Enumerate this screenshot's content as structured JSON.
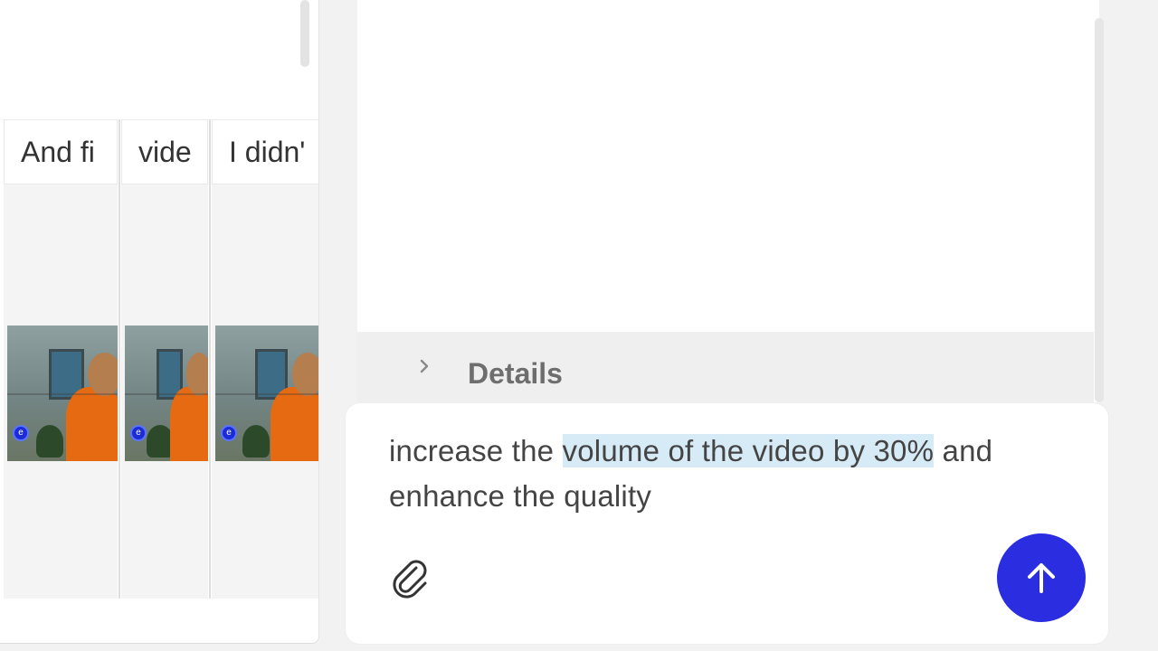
{
  "timeline": {
    "clips": [
      {
        "label": "And fi"
      },
      {
        "label": "vide"
      },
      {
        "label": "I didn'"
      }
    ]
  },
  "details": {
    "label": "Details"
  },
  "composer": {
    "text_before": "increase the ",
    "text_highlighted": "volume of the video by 30%",
    "text_after": " and enhance the quality"
  },
  "icons": {
    "details": "chevron-right-icon",
    "attach": "paperclip-icon",
    "send": "arrow-up-icon"
  },
  "colors": {
    "send_button": "#2a2ee0",
    "highlight": "#d7ebf7"
  }
}
